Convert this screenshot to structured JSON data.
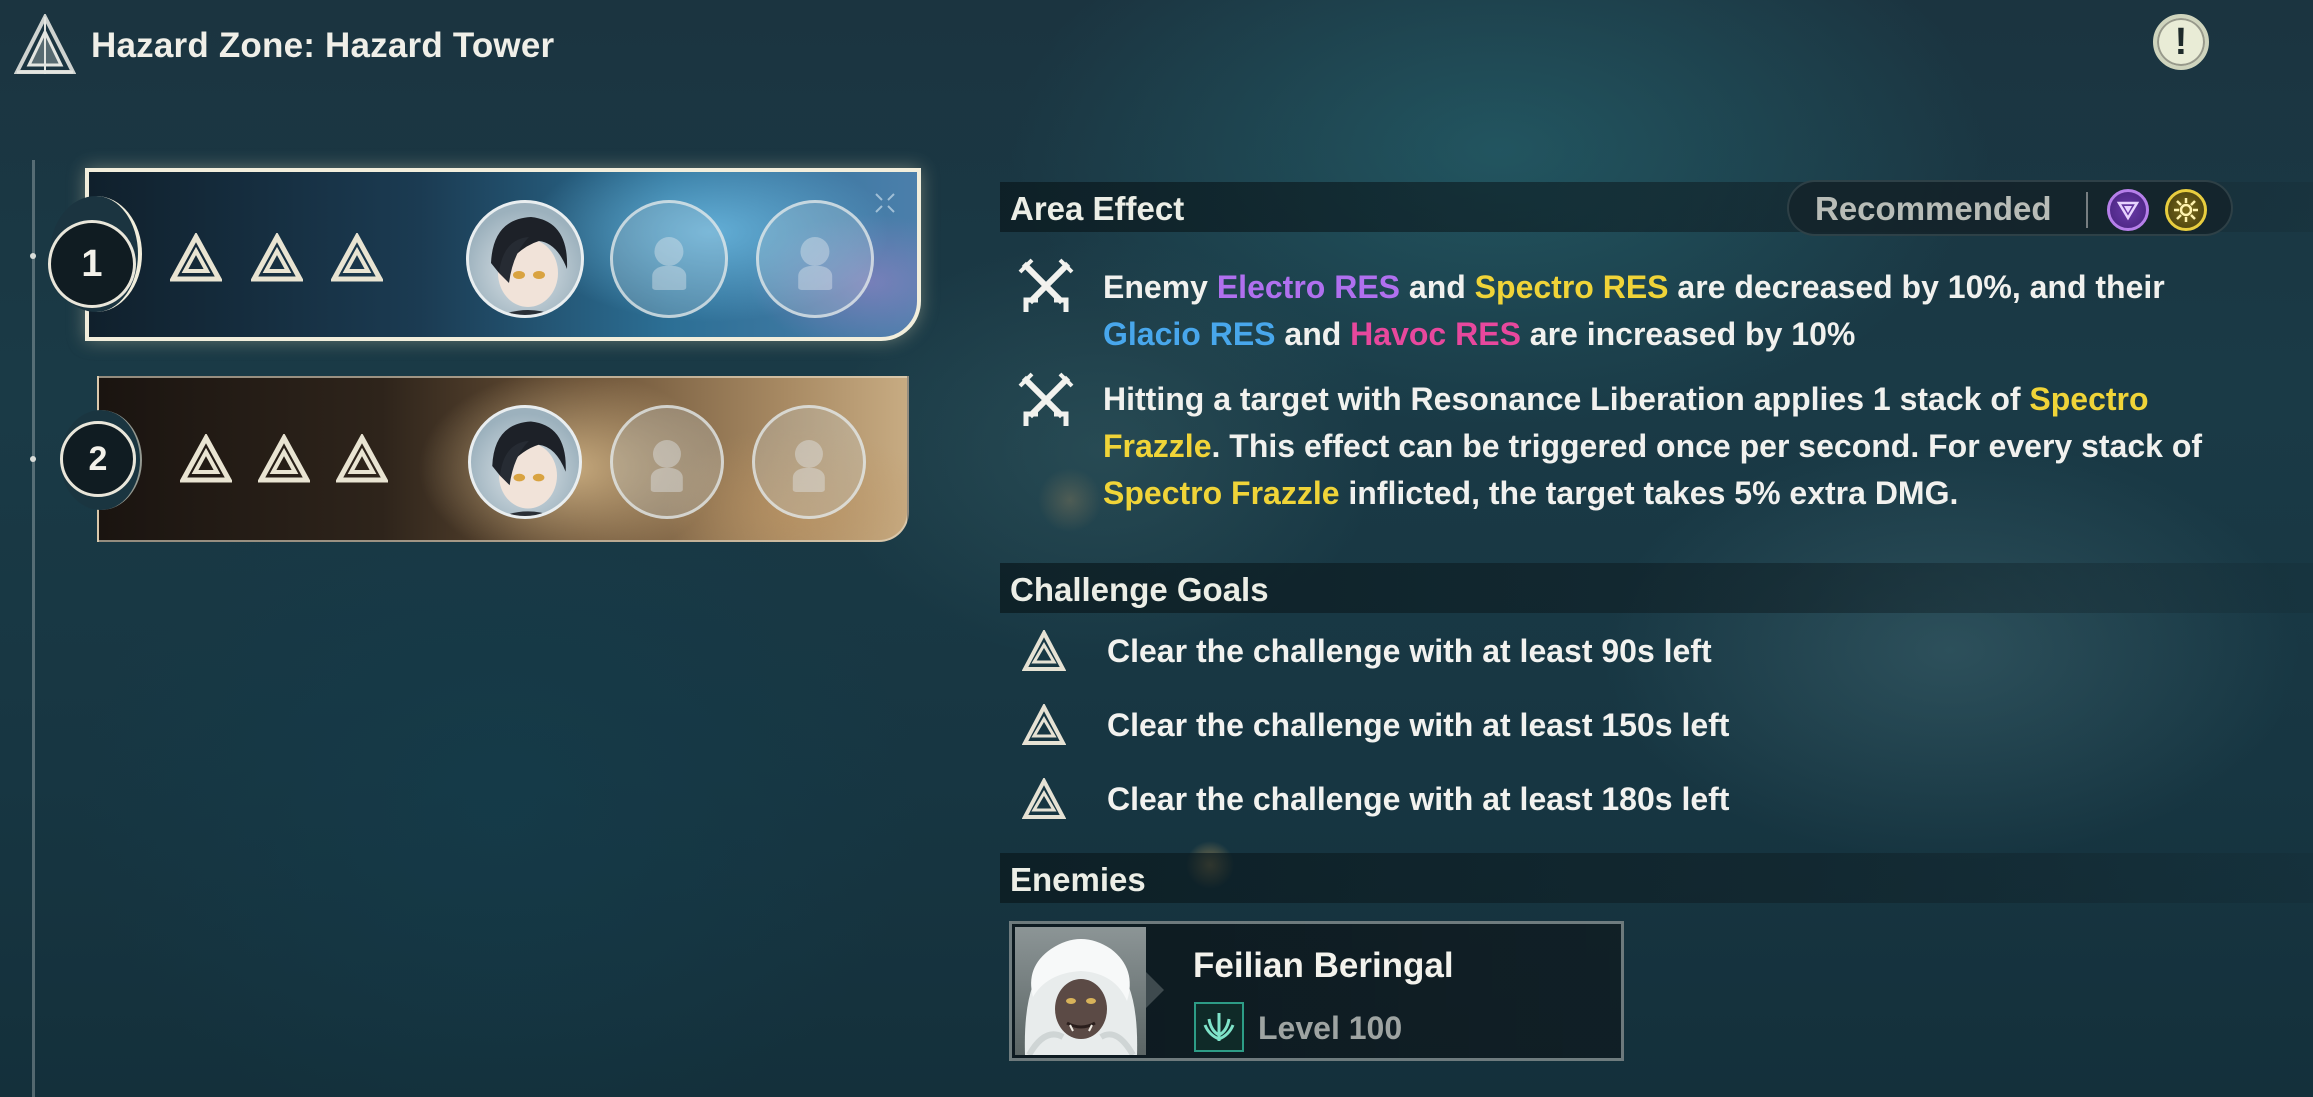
{
  "header": {
    "title": "Hazard Zone: Hazard Tower",
    "logo_icon": "tower-triangle-logo",
    "info_icon": "exclamation-icon",
    "info_label": "!"
  },
  "stages": [
    {
      "number": "1",
      "selected": true,
      "goal_icons": [
        "goal-triangle-icon",
        "goal-triangle-icon",
        "goal-triangle-icon"
      ],
      "team_slots": [
        "character-portrait",
        "empty",
        "empty"
      ]
    },
    {
      "number": "2",
      "selected": false,
      "goal_icons": [
        "goal-triangle-icon",
        "goal-triangle-icon",
        "goal-triangle-icon"
      ],
      "team_slots": [
        "character-portrait",
        "empty",
        "empty"
      ]
    }
  ],
  "area_effect": {
    "title": "Area Effect",
    "recommended_label": "Recommended",
    "recommended_elements": [
      "electro-icon",
      "spectro-icon"
    ],
    "effects": [
      {
        "icon": "crossed-swords-icon",
        "parts": [
          {
            "text": "Enemy ",
            "style": "plain"
          },
          {
            "text": "Electro RES",
            "style": "electro"
          },
          {
            "text": " and ",
            "style": "plain"
          },
          {
            "text": "Spectro RES",
            "style": "spectro"
          },
          {
            "text": " are decreased by 10%, and their ",
            "style": "plain"
          },
          {
            "text": "Glacio RES",
            "style": "glacio"
          },
          {
            "text": " and ",
            "style": "plain"
          },
          {
            "text": "Havoc RES",
            "style": "havoc"
          },
          {
            "text": " are increased by 10%",
            "style": "plain"
          }
        ]
      },
      {
        "icon": "crossed-swords-icon",
        "parts": [
          {
            "text": "Hitting a target with Resonance Liberation applies 1 stack of ",
            "style": "plain"
          },
          {
            "text": "Spectro Frazzle",
            "style": "spectro"
          },
          {
            "text": ". This effect can be triggered once per second. For every stack of ",
            "style": "plain"
          },
          {
            "text": "Spectro Frazzle",
            "style": "spectro"
          },
          {
            "text": " inflicted, the target takes 5% extra DMG.",
            "style": "plain"
          }
        ]
      }
    ]
  },
  "challenge_goals": {
    "title": "Challenge Goals",
    "items": [
      "Clear the challenge with at least 90s left",
      "Clear the challenge with at least 150s left",
      "Clear the challenge with at least 180s left"
    ]
  },
  "enemies": {
    "title": "Enemies",
    "list": [
      {
        "name": "Feilian Beringal",
        "level": "Level 100",
        "class_icon": "enemy-class-icon"
      }
    ]
  },
  "colors": {
    "electro": "#b070ef",
    "spectro": "#f0d438",
    "glacio": "#48a7ec",
    "havoc": "#e7489d"
  }
}
